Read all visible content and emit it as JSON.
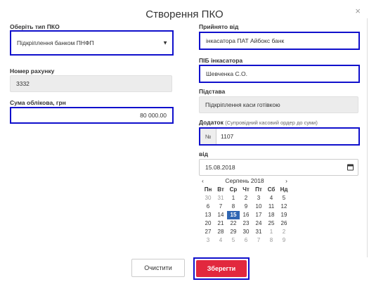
{
  "title": "Створення ПКО",
  "close_symbol": "×",
  "left": {
    "type_label": "Оберіть тип ПКО",
    "type_value": "Підкріплення банком ПНФП",
    "account_label": "Номер рахунку",
    "account_value": "3332",
    "amount_label": "Сума облікова, грн",
    "amount_value": "80 000.00"
  },
  "right": {
    "received_label": "Прийнято від",
    "received_value": "інкасатора ПАТ Айбокс банк",
    "collector_label": "ПІБ інкасатора",
    "collector_value": "Шевченка С.О.",
    "basis_label": "Підстава",
    "basis_value": "Підкріплення каси готівкою",
    "attachment_label": "Додаток",
    "attachment_hint": "(Супровідний касовий ордер до суми)",
    "attachment_prefix": "№",
    "attachment_value": "1107",
    "date_label": "від",
    "date_value": "15.08.2018"
  },
  "calendar": {
    "prev": "‹",
    "next": "›",
    "month": "Серпень 2018",
    "weekdays": [
      "Пн",
      "Вт",
      "Ср",
      "Чт",
      "Пт",
      "Сб",
      "Нд"
    ],
    "days": [
      [
        "30",
        "31",
        "1",
        "2",
        "3",
        "4",
        "5"
      ],
      [
        "6",
        "7",
        "8",
        "9",
        "10",
        "11",
        "12"
      ],
      [
        "13",
        "14",
        "15",
        "16",
        "17",
        "18",
        "19"
      ],
      [
        "20",
        "21",
        "22",
        "23",
        "24",
        "25",
        "26"
      ],
      [
        "27",
        "28",
        "29",
        "30",
        "31",
        "1",
        "2"
      ],
      [
        "3",
        "4",
        "5",
        "6",
        "7",
        "8",
        "9"
      ]
    ],
    "selected": "15"
  },
  "buttons": {
    "clear": "Очистити",
    "save": "Зберегти"
  },
  "colors": {
    "highlight": "#1010cc",
    "save": "#e2283e",
    "selected_day": "#2f66b3"
  }
}
